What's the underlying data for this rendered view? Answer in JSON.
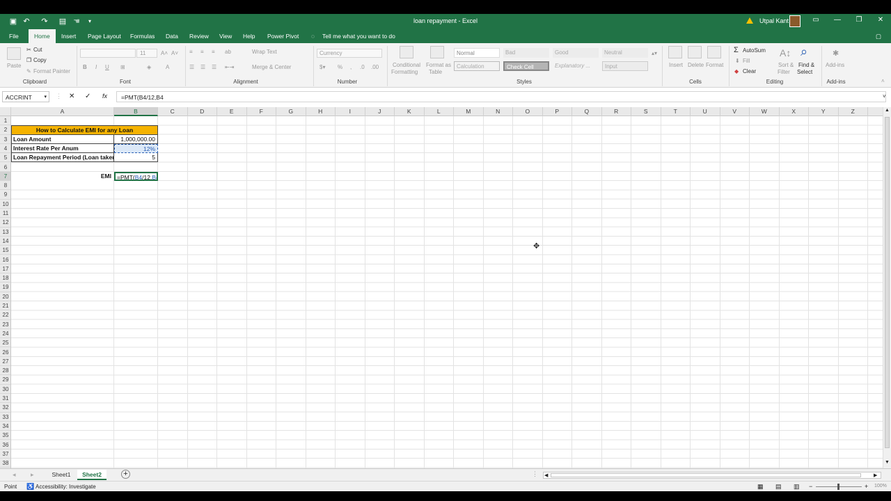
{
  "titlebar": {
    "title": "loan repayment  -  Excel",
    "user": "Utpal Kant",
    "qa_icons": [
      "save-icon",
      "undo-icon",
      "redo-icon",
      "form-icon",
      "touch-icon",
      "customize-icon"
    ]
  },
  "tabs": {
    "file": "File",
    "home": "Home",
    "insert": "Insert",
    "page_layout": "Page Layout",
    "formulas": "Formulas",
    "data": "Data",
    "review": "Review",
    "view": "View",
    "help": "Help",
    "power_pivot": "Power Pivot",
    "tell_me": "Tell me what you want to do"
  },
  "ribbon": {
    "clipboard": {
      "paste": "Paste",
      "cut": "Cut",
      "copy": "Copy",
      "format_painter": "Format Painter",
      "label": "Clipboard"
    },
    "font": {
      "size": "11",
      "bold": "B",
      "italic": "I",
      "underline": "U",
      "font_color": "A",
      "label": "Font"
    },
    "alignment": {
      "wrap": "Wrap Text",
      "merge": "Merge & Center",
      "label": "Alignment"
    },
    "number": {
      "format": "Currency",
      "percent": "%",
      "label": "Number"
    },
    "styles": {
      "conditional": "Conditional",
      "conditional2": "Formatting",
      "format_as": "Format as",
      "format_as2": "Table",
      "normal": "Normal",
      "bad": "Bad",
      "good": "Good",
      "neutral": "Neutral",
      "calculation": "Calculation",
      "check_cell": "Check Cell",
      "explanatory": "Explanatory ...",
      "input": "Input",
      "label": "Styles"
    },
    "cells": {
      "insert": "Insert",
      "delete": "Delete",
      "format": "Format",
      "label": "Cells"
    },
    "editing": {
      "autosum": "AutoSum",
      "fill": "Fill",
      "clear": "Clear",
      "sort": "Sort &",
      "sort2": "Filter",
      "find": "Find &",
      "find2": "Select",
      "label": "Editing"
    },
    "addins": {
      "addins": "Add-ins",
      "label": "Add-ins"
    }
  },
  "formula_bar": {
    "name_box": "ACCRINT",
    "cancel": "✕",
    "enter": "✓",
    "fx": "fx",
    "formula": "=PMT(B4/12,B4"
  },
  "columns": [
    "A",
    "B",
    "C",
    "D",
    "E",
    "F",
    "G",
    "H",
    "I",
    "J",
    "K",
    "L",
    "M",
    "N",
    "O",
    "P",
    "Q",
    "R",
    "S",
    "T",
    "U",
    "V",
    "W",
    "X",
    "Y",
    "Z"
  ],
  "rows": [
    "1",
    "2",
    "3",
    "4",
    "5",
    "6",
    "7",
    "8",
    "9",
    "10",
    "11",
    "12",
    "13",
    "14",
    "15",
    "16",
    "17",
    "18",
    "19",
    "20",
    "21",
    "22",
    "23",
    "24",
    "25",
    "26",
    "27",
    "28",
    "29",
    "30",
    "31",
    "32",
    "33",
    "34",
    "35",
    "36",
    "37",
    "38"
  ],
  "sheet": {
    "A2": "How to Calculate EMI for any Loan",
    "A3": "Loan Amount",
    "B3": "1,000,000.00",
    "A4": "Interest Rate Per Anum",
    "B4": "12%",
    "A5": "Loan Repayment Period (Loan taken",
    "B5": "5",
    "A7": "EMI",
    "B7_prefix": "=PMT(",
    "B7_ref1": "B4",
    "B7_mid": "/12,",
    "B7_ref2": "B4"
  },
  "sheet_tabs": {
    "sheet1": "Sheet1",
    "sheet2": "Sheet2",
    "add": "+"
  },
  "status": {
    "mode": "Point",
    "accessibility": "Accessibility: Investigate",
    "zoom": "100%"
  },
  "colors": {
    "excel_green": "#217346",
    "title_fill": "#f5b300",
    "ref_blue": "#2b5fb4",
    "ref_fill": "#dbe8f7"
  }
}
